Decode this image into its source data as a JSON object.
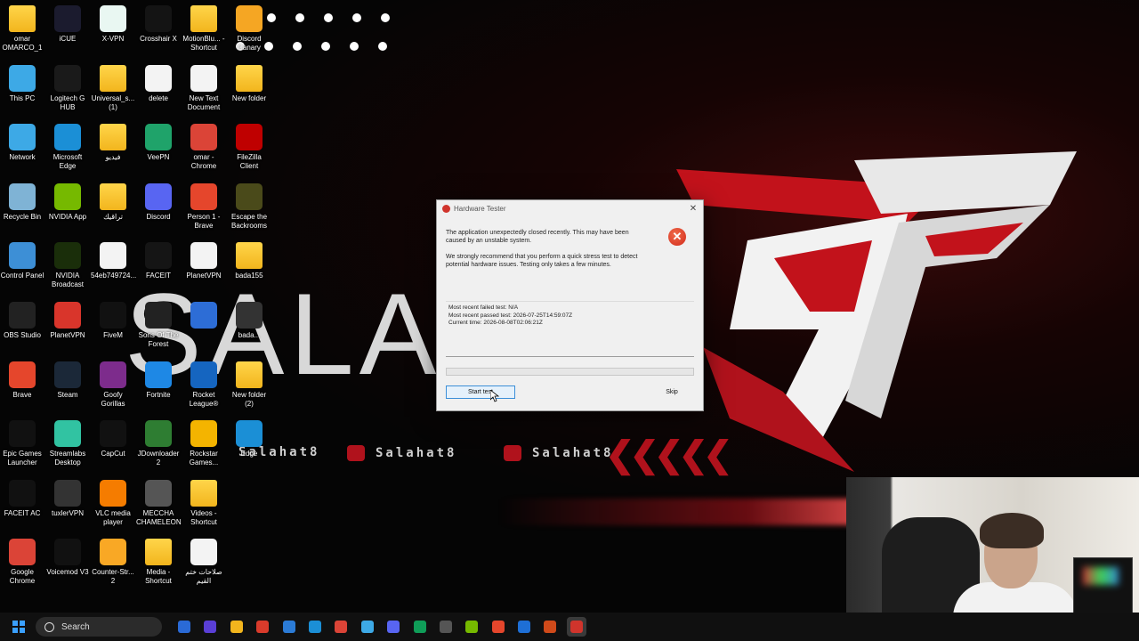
{
  "wallpaper": {
    "big_text": "SALAH",
    "brand_1": "Salahat8",
    "brand_2": "Salahat8",
    "brand_3": "Salahat8",
    "logo_text": "ST",
    "accent": "#b0121c"
  },
  "desktop_icons": [
    {
      "label": "omar OMARCO_1",
      "icon": "folder-icon",
      "type": "folder"
    },
    {
      "label": "iCUE",
      "icon": "icue-icon",
      "color": "#1b1b2e"
    },
    {
      "label": "X-VPN",
      "icon": "xvpn-icon",
      "color": "#e9f7f2"
    },
    {
      "label": "Crosshair X",
      "icon": "crosshair-icon",
      "color": "#141414"
    },
    {
      "label": "MotionBlu... - Shortcut",
      "icon": "folder-icon",
      "type": "folder"
    },
    {
      "label": "Discord Canary",
      "icon": "discord-canary-icon",
      "color": "#f5a623"
    },
    {
      "label": "This PC",
      "icon": "monitor-icon",
      "color": "#3da9e6"
    },
    {
      "label": "Logitech G HUB",
      "icon": "logitech-icon",
      "color": "#1a1a1a"
    },
    {
      "label": "Universal_s... (1)",
      "icon": "folder-icon",
      "type": "folder"
    },
    {
      "label": "delete",
      "icon": "gear-file-icon",
      "type": "doc"
    },
    {
      "label": "New Text Document",
      "icon": "text-document-icon",
      "type": "doc"
    },
    {
      "label": "New folder",
      "icon": "folder-icon",
      "type": "folder"
    },
    {
      "label": "Network",
      "icon": "network-icon",
      "color": "#3da9e6"
    },
    {
      "label": "Microsoft Edge",
      "icon": "edge-icon",
      "color": "#1b8fd6"
    },
    {
      "label": "فيديو",
      "icon": "folder-icon",
      "type": "folder"
    },
    {
      "label": "VeePN",
      "icon": "veepn-icon",
      "color": "#1fa36a"
    },
    {
      "label": "omar - Chrome",
      "icon": "chrome-icon",
      "color": "#db4437"
    },
    {
      "label": "FileZilla Client",
      "icon": "filezilla-icon",
      "color": "#bf0000"
    },
    {
      "label": "Recycle Bin",
      "icon": "recycle-bin-icon",
      "color": "#7fb3d5"
    },
    {
      "label": "NVIDIA App",
      "icon": "nvidia-icon",
      "color": "#76b900"
    },
    {
      "label": "تراقيك",
      "icon": "folder-icon",
      "type": "folder"
    },
    {
      "label": "Discord",
      "icon": "discord-icon",
      "color": "#5865f2"
    },
    {
      "label": "Person 1 - Brave",
      "icon": "brave-icon",
      "color": "#e5462c"
    },
    {
      "label": "Escape the Backrooms",
      "icon": "game-icon",
      "color": "#4a4a1a"
    },
    {
      "label": "Control Panel",
      "icon": "control-panel-icon",
      "color": "#3d8fd6"
    },
    {
      "label": "NVIDIA Broadcast",
      "icon": "nvidia-broadcast-icon",
      "color": "#1a2e0a"
    },
    {
      "label": "54eb749724...",
      "icon": "file-icon",
      "type": "doc"
    },
    {
      "label": "FACEIT",
      "icon": "faceit-icon",
      "color": "#151515"
    },
    {
      "label": "PlanetVPN",
      "icon": "blank-file-icon",
      "type": "doc"
    },
    {
      "label": "bada155",
      "icon": "folder-icon",
      "type": "folder"
    },
    {
      "label": "OBS Studio",
      "icon": "obs-icon",
      "color": "#222"
    },
    {
      "label": "PlanetVPN",
      "icon": "planetvpn-icon",
      "color": "#d9352b"
    },
    {
      "label": "FiveM",
      "icon": "fivem-icon",
      "color": "#111"
    },
    {
      "label": "Sons Of The Forest",
      "icon": "game-icon",
      "color": "#222"
    },
    {
      "label": "",
      "icon": "app-icon",
      "color": "#2d6dd6"
    },
    {
      "label": "bada...",
      "icon": "app-icon",
      "color": "#333"
    },
    {
      "label": "Brave",
      "icon": "brave-icon",
      "color": "#e5462c"
    },
    {
      "label": "Steam",
      "icon": "steam-icon",
      "color": "#1b2838"
    },
    {
      "label": "Goofy Gorillas",
      "icon": "game-icon",
      "color": "#7d2c8c"
    },
    {
      "label": "Fortnite",
      "icon": "fortnite-icon",
      "color": "#1e88e5"
    },
    {
      "label": "Rocket League®",
      "icon": "rocket-league-icon",
      "color": "#1565c0"
    },
    {
      "label": "New folder (2)",
      "icon": "folder-icon",
      "type": "folder"
    },
    {
      "label": "Epic Games Launcher",
      "icon": "epic-icon",
      "color": "#111"
    },
    {
      "label": "Streamlabs Desktop",
      "icon": "streamlabs-icon",
      "color": "#31c3a2"
    },
    {
      "label": "CapCut",
      "icon": "capcut-icon",
      "color": "#111"
    },
    {
      "label": "JDownloader 2",
      "icon": "jdownloader-icon",
      "color": "#2e7d32"
    },
    {
      "label": "Rockstar Games...",
      "icon": "rockstar-icon",
      "color": "#f4b400"
    },
    {
      "label": "Edge",
      "icon": "edge-icon",
      "color": "#1b8fd6"
    },
    {
      "label": "FACEIT AC",
      "icon": "faceit-ac-icon",
      "color": "#111"
    },
    {
      "label": "tuxlerVPN",
      "icon": "tuxler-icon",
      "color": "#333"
    },
    {
      "label": "VLC media player",
      "icon": "vlc-icon",
      "color": "#f57c00"
    },
    {
      "label": "MECCHA CHAMELEON",
      "icon": "game-icon",
      "color": "#555"
    },
    {
      "label": "Videos - Shortcut",
      "icon": "folder-icon",
      "type": "folder"
    },
    {
      "label": "",
      "icon": "blank-icon",
      "color": "transparent"
    },
    {
      "label": "Google Chrome",
      "icon": "chrome-icon",
      "color": "#db4437"
    },
    {
      "label": "Voicemod V3",
      "icon": "voicemod-icon",
      "color": "#111"
    },
    {
      "label": "Counter-Str... 2",
      "icon": "cs2-icon",
      "color": "#f9a825"
    },
    {
      "label": "Media - Shortcut",
      "icon": "folder-icon",
      "type": "folder"
    },
    {
      "label": "صلاحات ختم القيم",
      "icon": "text-document-icon",
      "type": "doc"
    }
  ],
  "dialog": {
    "title": "Hardware Tester",
    "message_1": "The application unexpectedly closed recently. This may have been caused by an unstable system.",
    "message_2": "We strongly recommend that you perform a quick stress test to detect potential hardware issues. Testing only takes a few minutes.",
    "failed_test": "Most recent failed test: N/A",
    "passed_test": "Most recent passed test: 2026-07-25T14:59:07Z",
    "current_time": "Current time: 2026-08-08T02:06:21Z",
    "progress_percent": 0,
    "start_label": "Start test",
    "skip_label": "Skip",
    "close_symbol": "✕",
    "error_symbol": "✕"
  },
  "taskbar": {
    "search_placeholder": "Search",
    "apps": [
      {
        "icon": "widgets-icon",
        "color": "#2a6ad6"
      },
      {
        "icon": "copilot-icon",
        "color": "#5a3fd6"
      },
      {
        "icon": "file-explorer-icon",
        "color": "#f2b51d"
      },
      {
        "icon": "store-icon",
        "color": "#d93b2b"
      },
      {
        "icon": "settings-icon",
        "color": "#2b7bd6"
      },
      {
        "icon": "edge-icon",
        "color": "#1b8fd6"
      },
      {
        "icon": "chrome-icon",
        "color": "#db4437"
      },
      {
        "icon": "app-icon",
        "color": "#3da9e6"
      },
      {
        "icon": "discord-icon",
        "color": "#5865f2"
      },
      {
        "icon": "chrome-icon",
        "color": "#0f9d58"
      },
      {
        "icon": "steam-icon",
        "color": "#555"
      },
      {
        "icon": "nvidia-icon",
        "color": "#76b900"
      },
      {
        "icon": "brave-icon",
        "color": "#e5462c"
      },
      {
        "icon": "defender-icon",
        "color": "#1e6fd6"
      },
      {
        "icon": "faceit-ac-icon",
        "color": "#d04a1a"
      },
      {
        "icon": "hardware-tester-icon",
        "color": "#d0342c",
        "active": true
      }
    ]
  }
}
